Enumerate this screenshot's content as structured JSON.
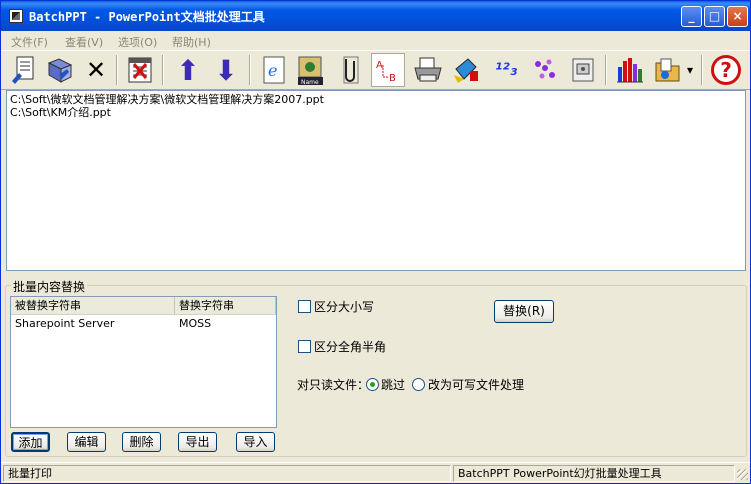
{
  "window": {
    "title": "BatchPPT - PowerPoint文档批处理工具",
    "min_label": "_",
    "max_label": "□",
    "close_label": "×"
  },
  "menu": [
    {
      "label": "文件(F)"
    },
    {
      "label": "查看(V)"
    },
    {
      "label": "选项(O)"
    },
    {
      "label": "帮助(H)"
    }
  ],
  "toolbar": {
    "icons": [
      "add-files-icon",
      "add-folder-icon",
      "remove-icon",
      "clear-list-icon",
      "move-up-icon",
      "move-down-icon",
      "web-icon",
      "rename-icon",
      "attach-icon",
      "replace-text-icon",
      "print-icon",
      "fill-icon",
      "numbering-icon",
      "pattern-icon",
      "slide-icon",
      "chart-icon",
      "folder-options-icon",
      "help-icon"
    ],
    "glyphs": {
      "remove": "✕",
      "move_up": "⬆",
      "move_down": "⬇",
      "numbering": "¹²₃",
      "help": "?",
      "dropdown": "▾"
    }
  },
  "files": [
    "C:\\Soft\\微软文档管理解决方案\\微软文档管理解决方案2007.ppt",
    "C:\\Soft\\KM介绍.ppt"
  ],
  "replace_group": {
    "title": "批量内容替换",
    "columns": [
      "被替换字符串",
      "替换字符串"
    ],
    "rows": [
      {
        "find": "Sharepoint Server",
        "replace": "MOSS"
      }
    ],
    "buttons": {
      "add": "添加",
      "edit": "编辑",
      "delete": "删除",
      "export": "导出",
      "import": "导入",
      "replace": "替换(R)"
    },
    "options": {
      "case_sensitive": "区分大小写",
      "width_sensitive": "区分全角半角",
      "readonly_label": "对只读文件：",
      "skip": "跳过",
      "make_writable": "改为可写文件处理"
    }
  },
  "status": {
    "left": "批量打印",
    "right": "BatchPPT PowerPoint幻灯批量处理工具"
  }
}
